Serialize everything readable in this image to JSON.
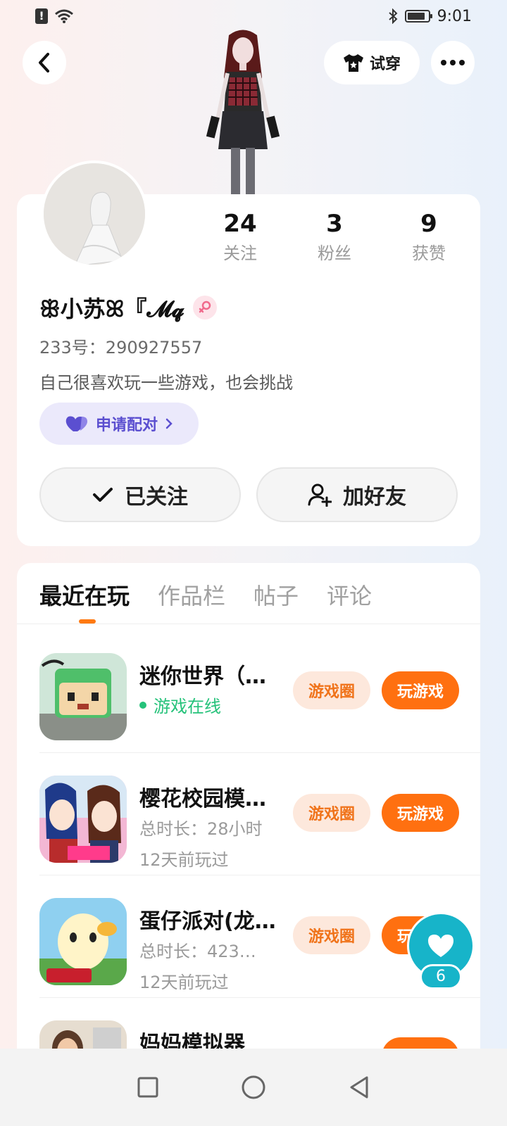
{
  "status_bar": {
    "time": "9:01"
  },
  "header": {
    "tryon_label": "试穿"
  },
  "profile": {
    "stats": [
      {
        "num": "24",
        "label": "关注"
      },
      {
        "num": "3",
        "label": "粉丝"
      },
      {
        "num": "9",
        "label": "获赞"
      }
    ],
    "username": "ꕥ小苏ꕤ『𝓜𝓺",
    "user_id": "233号：290927557",
    "bio": "自己很喜欢玩一些游戏，也会挑战",
    "match_label": "申请配对",
    "follow_label": "已关注",
    "add_friend_label": "加好友"
  },
  "tabs": [
    "最近在玩",
    "作品栏",
    "帖子",
    "评论"
  ],
  "games": [
    {
      "title": "迷你世界（…",
      "status": "游戏在线",
      "circle_label": "游戏圈",
      "play_label": "玩游戏"
    },
    {
      "title": "樱花校园模…",
      "duration": "总时长：28小时",
      "last_played": "12天前玩过",
      "circle_label": "游戏圈",
      "play_label": "玩游戏"
    },
    {
      "title": "蛋仔派对(龙…",
      "duration": "总时长：423…",
      "last_played": "12天前玩过",
      "circle_label": "游戏圈",
      "play_label": "玩游戏"
    },
    {
      "title": "妈妈模拟器"
    }
  ],
  "like_float": {
    "count": "6"
  },
  "colors": {
    "accent": "#ff7010",
    "online": "#25c27a",
    "match": "#5b4fd0",
    "like": "#17b4c9"
  }
}
